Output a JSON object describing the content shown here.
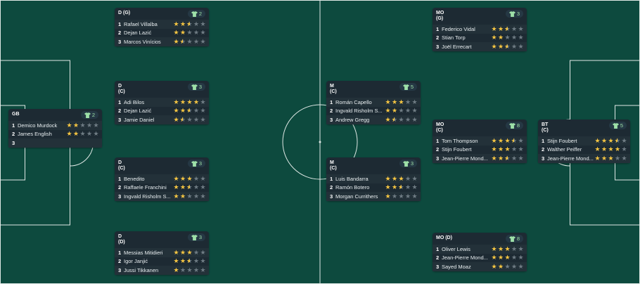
{
  "colors": {
    "pitch": "#0d4a3e",
    "lines": "#dfe8e5",
    "card": "#1d2a33",
    "star": "#f5c542",
    "badge_text": "#9ee0a8"
  },
  "positions": [
    {
      "id": "gk",
      "pos": "GB",
      "count": "2",
      "players": [
        {
          "rank": "1",
          "name": "Demico Murdock",
          "stars": 2
        },
        {
          "rank": "2",
          "name": "James English",
          "stars": 2
        },
        {
          "rank": "3",
          "name": "",
          "stars": null
        }
      ]
    },
    {
      "id": "dg",
      "pos": "D (G)",
      "count": "2",
      "players": [
        {
          "rank": "1",
          "name": "Rafael Villalba",
          "stars": 2.5
        },
        {
          "rank": "2",
          "name": "Dejan Lazić",
          "stars": 2
        },
        {
          "rank": "3",
          "name": "Marcos Vinícios",
          "stars": 1.5
        }
      ]
    },
    {
      "id": "dc1",
      "pos": "D\n(C)",
      "count": "3",
      "players": [
        {
          "rank": "1",
          "name": "Adi Bilos",
          "stars": 4
        },
        {
          "rank": "2",
          "name": "Dejan Lazić",
          "stars": 2.5
        },
        {
          "rank": "3",
          "name": "Jamie Daniel",
          "stars": 1.5
        }
      ]
    },
    {
      "id": "dc2",
      "pos": "D\n(C)",
      "count": "3",
      "players": [
        {
          "rank": "1",
          "name": "Benedito",
          "stars": 3
        },
        {
          "rank": "2",
          "name": "Raffaele Franchini",
          "stars": 2.5
        },
        {
          "rank": "3",
          "name": "Ingvald Risholm S...",
          "stars": 2
        }
      ]
    },
    {
      "id": "dd",
      "pos": "D\n(D)",
      "count": "3",
      "players": [
        {
          "rank": "1",
          "name": "Messias Mitidieri",
          "stars": 3
        },
        {
          "rank": "2",
          "name": "Igor Janjić",
          "stars": 2.5
        },
        {
          "rank": "3",
          "name": "Jussi Tikkanen",
          "stars": 1
        }
      ]
    },
    {
      "id": "mc1",
      "pos": "M\n(C)",
      "count": "5",
      "players": [
        {
          "rank": "1",
          "name": "Román Capello",
          "stars": 3
        },
        {
          "rank": "2",
          "name": "Ingvald Risholm S...",
          "stars": 2
        },
        {
          "rank": "3",
          "name": "Andrew Gregg",
          "stars": 1.5
        }
      ]
    },
    {
      "id": "mc2",
      "pos": "M\n(C)",
      "count": "3",
      "players": [
        {
          "rank": "1",
          "name": "Luis Bandarra",
          "stars": 3
        },
        {
          "rank": "2",
          "name": "Ramón Botero",
          "stars": 2.5
        },
        {
          "rank": "3",
          "name": "Morgan Currithers",
          "stars": 1
        }
      ]
    },
    {
      "id": "mog",
      "pos": "MO\n(G)",
      "count": "3",
      "players": [
        {
          "rank": "1",
          "name": "Federico Vidal",
          "stars": 2.5
        },
        {
          "rank": "2",
          "name": "Stian Torp",
          "stars": 2
        },
        {
          "rank": "3",
          "name": "Joël Errecart",
          "stars": 2.5
        }
      ]
    },
    {
      "id": "moc",
      "pos": "MO\n(C)",
      "count": "8",
      "players": [
        {
          "rank": "1",
          "name": "Tom Thompson",
          "stars": 3.5
        },
        {
          "rank": "2",
          "name": "Stijn Foubert",
          "stars": 3
        },
        {
          "rank": "3",
          "name": "Jean-Pierre Mond...",
          "stars": 2.5
        }
      ]
    },
    {
      "id": "mod",
      "pos": "MO (D)",
      "count": "8",
      "players": [
        {
          "rank": "1",
          "name": "Oliver Lewis",
          "stars": 3
        },
        {
          "rank": "2",
          "name": "Jean-Pierre Mond...",
          "stars": 3
        },
        {
          "rank": "3",
          "name": "Sayed Moaz",
          "stars": 2
        }
      ]
    },
    {
      "id": "btc",
      "pos": "BT\n(C)",
      "count": "5",
      "players": [
        {
          "rank": "1",
          "name": "Stijn Foubert",
          "stars": 3.5
        },
        {
          "rank": "2",
          "name": "Walther Peiffer",
          "stars": 4
        },
        {
          "rank": "3",
          "name": "Jean-Pierre Mond...",
          "stars": 3
        }
      ]
    }
  ]
}
